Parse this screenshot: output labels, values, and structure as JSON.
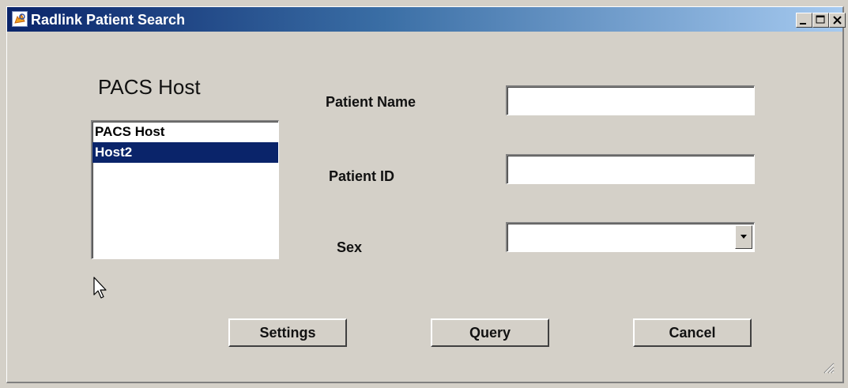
{
  "window": {
    "title": "Radlink Patient Search",
    "app_icon": "radlink-app-icon",
    "controls": {
      "minimize": "minimize-icon",
      "maximize": "maximize-icon",
      "close": "close-icon"
    }
  },
  "pacs": {
    "heading": "PACS Host",
    "items": [
      {
        "label": "PACS Host",
        "selected": false
      },
      {
        "label": "Host2",
        "selected": true
      }
    ]
  },
  "form": {
    "patient_name": {
      "label": "Patient Name",
      "value": ""
    },
    "patient_id": {
      "label": "Patient ID",
      "value": ""
    },
    "sex": {
      "label": "Sex",
      "value": ""
    }
  },
  "buttons": {
    "settings": "Settings",
    "query": "Query",
    "cancel": "Cancel"
  },
  "colors": {
    "selection": "#0a246a",
    "face": "#d4d0c8",
    "title_gradient_start": "#0a246a",
    "title_gradient_end": "#a6caf0"
  }
}
